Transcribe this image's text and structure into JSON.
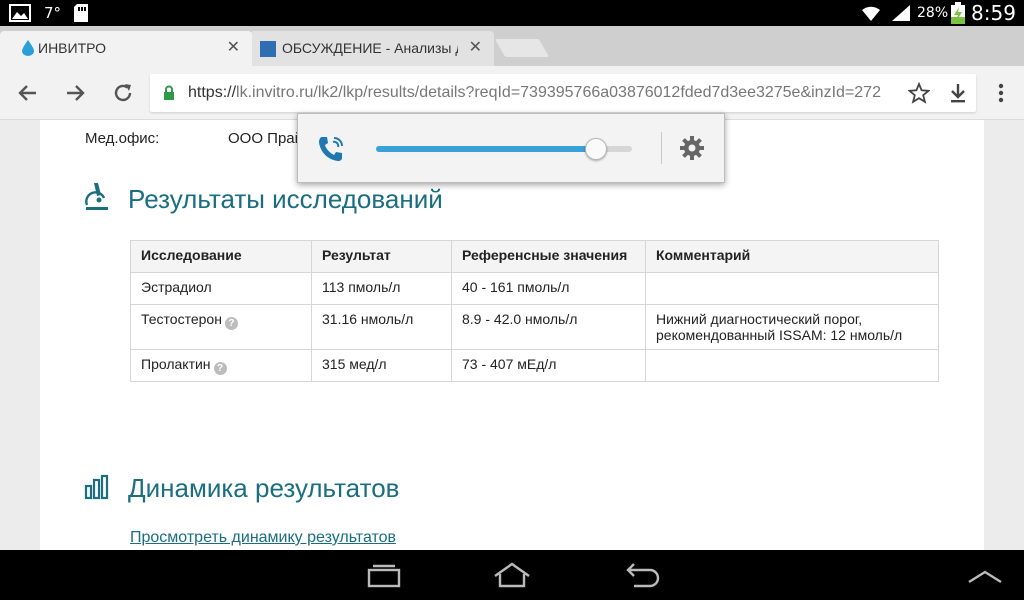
{
  "status_bar": {
    "temperature": "7°",
    "battery_percent": "28%",
    "time": "8:59"
  },
  "tabs": [
    {
      "title": "ИНВИТРО",
      "close": "✕",
      "active": true
    },
    {
      "title": "ОБСУЖДЕНИЕ - Анализы д",
      "close": "✕",
      "active": false
    }
  ],
  "toolbar": {
    "url_prefix": "https://",
    "url_rest": "lk.invitro.ru/lk2/lkp/results/details?reqId=739395766a03876012fded7d3ee3275e&inzId=272"
  },
  "page": {
    "med_office_label": "Мед.офис:",
    "med_office_value": "ООО Прай",
    "results_title": "Результаты исследований",
    "results_table": {
      "headers": [
        "Исследование",
        "Результат",
        "Референсные значения",
        "Комментарий"
      ],
      "rows": [
        {
          "test": "Эстрадиол",
          "result": "113 пмоль/л",
          "reference": "40 - 161 пмоль/л",
          "comment": ""
        },
        {
          "test": "Тестостерон",
          "result": "31.16 нмоль/л",
          "reference": "8.9 - 42.0 нмоль/л",
          "comment": "Нижний диагностический порог, рекомендованный ISSAM: 12 нмоль/л"
        },
        {
          "test": "Пролактин",
          "result": "315 мед/л",
          "reference": "73 - 407 мЕд/л",
          "comment": ""
        }
      ],
      "help_glyph": "?"
    },
    "dynamics_title": "Динамика результатов",
    "dynamics_link": "Просмотреть динамику результатов"
  },
  "volume_popup": {
    "level": 0.86
  },
  "colors": {
    "accent": "#1a6e80",
    "slider_fill": "#3aa0d8",
    "secure_lock": "#2e9a47"
  }
}
